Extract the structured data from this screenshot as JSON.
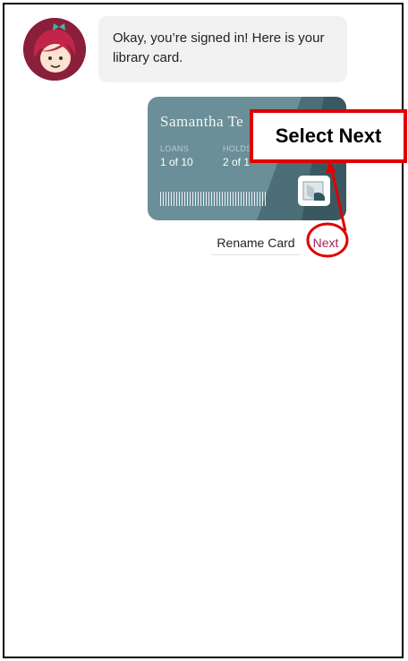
{
  "chat": {
    "message": "Okay, you’re signed in! Here is your library card."
  },
  "card": {
    "holder_name": "Samantha Te",
    "loans_label": "LOANS",
    "loans_value": "1 of 10",
    "holds_label": "HOLDS",
    "holds_value": "2 of 1",
    "color": "#6b8f98"
  },
  "actions": {
    "rename_label": "Rename Card",
    "next_label": "Next",
    "next_color": "#a3245a"
  },
  "annotation": {
    "callout_text": "Select Next",
    "highlight_color": "#e00000"
  },
  "icons": [
    "avatar-icon",
    "card-library-icon"
  ]
}
